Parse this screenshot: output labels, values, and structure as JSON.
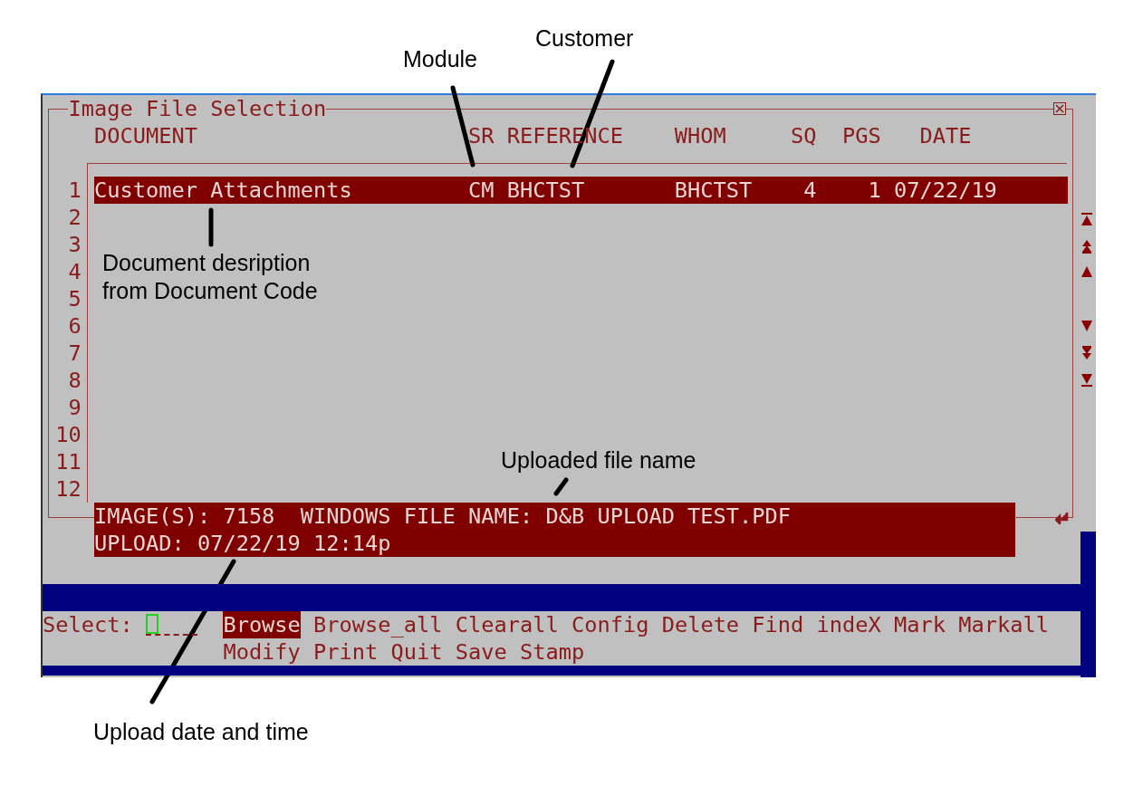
{
  "window": {
    "title": "Image File Selection"
  },
  "columns": [
    "DOCUMENT",
    "SR",
    "REFERENCE",
    "WHOM",
    "SQ",
    "PGS",
    "DATE"
  ],
  "rows": [
    {
      "number": "1",
      "document": "Customer Attachments",
      "sr": "CM",
      "reference": "BHCTST",
      "whom": "BHCTST",
      "sq": "4",
      "pgs": "1",
      "date": "07/22/19",
      "selected": true
    },
    {
      "number": "2",
      "selected": false
    },
    {
      "number": "3",
      "selected": false
    },
    {
      "number": "4",
      "selected": false
    },
    {
      "number": "5",
      "selected": false
    },
    {
      "number": "6",
      "selected": false
    },
    {
      "number": "7",
      "selected": false
    },
    {
      "number": "8",
      "selected": false
    },
    {
      "number": "9",
      "selected": false
    },
    {
      "number": "10",
      "selected": false
    },
    {
      "number": "11",
      "selected": false
    },
    {
      "number": "12",
      "selected": false
    }
  ],
  "details": [
    "IMAGE(S): 7158  WINDOWS FILE NAME: D&B UPLOAD TEST.PDF",
    "UPLOAD: 07/22/19 12:14p"
  ],
  "prompt": {
    "label": "Select:"
  },
  "commands": [
    {
      "label": "Browse",
      "selected": true
    },
    {
      "label": "Browse_all",
      "selected": false
    },
    {
      "label": "Clearall",
      "selected": false
    },
    {
      "label": "Config",
      "selected": false
    },
    {
      "label": "Delete",
      "selected": false
    },
    {
      "label": "Find",
      "selected": false
    },
    {
      "label": "indeX",
      "selected": false
    },
    {
      "label": "Mark",
      "selected": false
    },
    {
      "label": "Markall",
      "selected": false
    },
    {
      "label": "Modify",
      "selected": false
    },
    {
      "label": "Print",
      "selected": false
    },
    {
      "label": "Quit",
      "selected": false
    },
    {
      "label": "Save",
      "selected": false
    },
    {
      "label": "Stamp",
      "selected": false
    }
  ],
  "annotations": [
    {
      "text": "Customer"
    },
    {
      "text": "Module"
    },
    {
      "text": "Document desription\nfrom Document Code"
    },
    {
      "text": "Uploaded file name"
    },
    {
      "text": "Upload date and time"
    }
  ]
}
